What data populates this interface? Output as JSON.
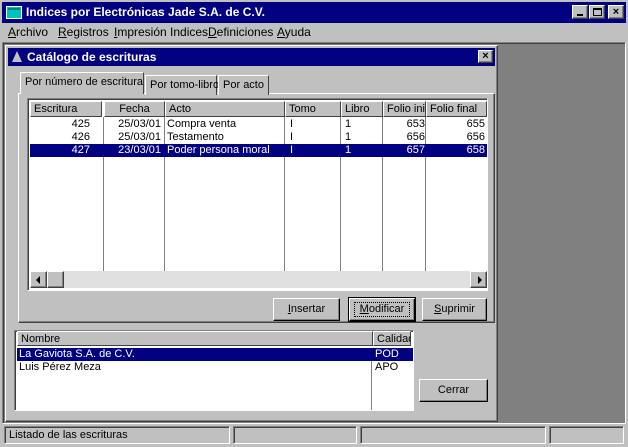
{
  "window": {
    "title": "Indices por Electrónicas Jade S.A. de C.V.",
    "minimize_label": "_",
    "maximize_label": "□",
    "close_label": "×"
  },
  "menu": [
    {
      "pre": "",
      "ul": "A",
      "post": "rchivo"
    },
    {
      "pre": "",
      "ul": "R",
      "post": "egistros"
    },
    {
      "pre": "",
      "ul": "I",
      "post": "mpresión Indices"
    },
    {
      "pre": "",
      "ul": "D",
      "post": "efiniciones"
    },
    {
      "pre": "",
      "ul": "A",
      "post": "yuda"
    }
  ],
  "child": {
    "title": "Catálogo de escrituras",
    "close_label": "×"
  },
  "tabs": [
    "Por número de escritura",
    "Por tomo-libro",
    "Por acto"
  ],
  "grid": {
    "columns": [
      "Escritura",
      "Fecha",
      "Acto",
      "Tomo",
      "Libro",
      "Folio inicial",
      "Folio final"
    ],
    "rows": [
      {
        "escritura": "425",
        "fecha": "25/03/01",
        "acto": "Compra venta",
        "tomo": "I",
        "libro": "1",
        "folio_ini": "653",
        "folio_fin": "655"
      },
      {
        "escritura": "426",
        "fecha": "25/03/01",
        "acto": "Testamento",
        "tomo": "I",
        "libro": "1",
        "folio_ini": "656",
        "folio_fin": "656"
      },
      {
        "escritura": "427",
        "fecha": "23/03/01",
        "acto": "Poder persona moral",
        "tomo": "I",
        "libro": "1",
        "folio_ini": "657",
        "folio_fin": "658"
      }
    ],
    "selected_row": 2
  },
  "buttons": {
    "insertar": {
      "pre": "",
      "ul": "I",
      "post": "nsertar"
    },
    "modificar": {
      "pre": "",
      "ul": "M",
      "post": "odificar"
    },
    "suprimir": {
      "pre": "",
      "ul": "S",
      "post": "uprimir"
    },
    "cerrar": "Cerrar"
  },
  "people": {
    "columns": [
      "Nombre",
      "Calidad"
    ],
    "rows": [
      {
        "nombre": "La Gaviota S.A. de C.V.",
        "calidad": "POD"
      },
      {
        "nombre": "Luis Pérez Meza",
        "calidad": "APO"
      }
    ],
    "selected_row": 0
  },
  "status": {
    "main": "Listado de las escrituras"
  },
  "colors": {
    "title_bar": "#000080",
    "selection": "#000080",
    "face": "#c0c0c0",
    "mdi_background": "#808080"
  }
}
